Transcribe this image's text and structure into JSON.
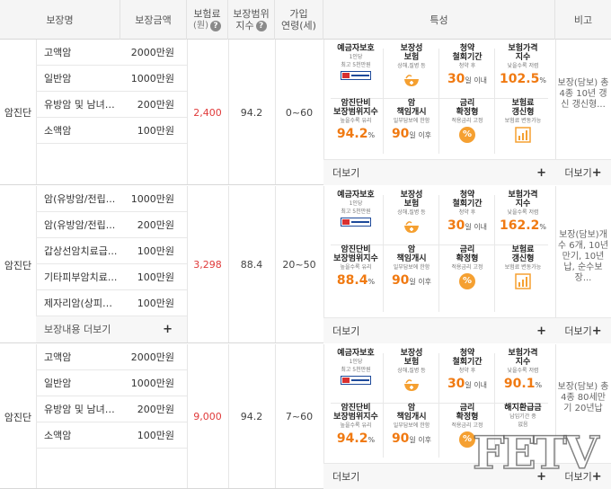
{
  "header": {
    "col_coverage_name": "보장명",
    "col_coverage_amount": "보장금액",
    "col_premium": "보험료",
    "col_premium_unit": "(원)",
    "col_index": "보장범위",
    "col_index_2": "지수",
    "col_age": "가입",
    "col_age_2": "연령(세)",
    "col_features": "특성",
    "col_note": "비고"
  },
  "feature_labels": {
    "deposit_title": "예금자보호",
    "deposit_sub1": "1인당",
    "deposit_sub2": "최고 5천만원",
    "savings_title1": "보장성",
    "savings_title2": "보험",
    "savings_sub": "상해,질병 등",
    "withdraw_title1": "청약",
    "withdraw_title2": "철회기간",
    "withdraw_sub": "청약 후",
    "withdraw_unit": "일 이내",
    "price_title1": "보험가격",
    "price_title2": "지수",
    "price_sub": "낮을수록 저렴",
    "range_title1": "암진단비",
    "range_title2": "보장범위지수",
    "range_sub": "높을수록 유리",
    "resp_title1": "암",
    "resp_title2": "책임개시",
    "resp_sub": "일부담보에 한함",
    "resp_unit": "일 이후",
    "rate_title1": "금리",
    "rate_title2": "확정형",
    "rate_sub": "적용금리 고정",
    "renew_title1": "보험료",
    "renew_title2": "갱신형",
    "renew_sub": "보험료 변동가능",
    "refund_title1": "해지환급금",
    "refund_title2": "납입기간 중",
    "refund_sub": "없음"
  },
  "more_label": "더보기",
  "coverage_more_label": "보장내용 더보기",
  "products": [
    {
      "category": "암진단",
      "premium": "2,400",
      "index": "94.2",
      "age": "0~60",
      "coverages": [
        {
          "name": "고액암",
          "amount": "2000만원"
        },
        {
          "name": "일반암",
          "amount": "1000만원"
        },
        {
          "name": "유방암 및 남녀생...",
          "amount": "200만원"
        },
        {
          "name": "소액암",
          "amount": "100만원"
        }
      ],
      "withdraw_days": "30",
      "price_index": "102.5",
      "range_index": "94.2",
      "resp_days": "90",
      "note": "보장(담보) 총 4종 10년 갱신 갱신형..."
    },
    {
      "category": "암진단",
      "premium": "3,298",
      "index": "88.4",
      "age": "20~50",
      "coverages": [
        {
          "name": "암(유방암/전립...",
          "amount": "1000만원"
        },
        {
          "name": "암(유방암/전립...",
          "amount": "200만원"
        },
        {
          "name": "갑상선암치료급...",
          "amount": "100만원"
        },
        {
          "name": "기타피부암치료...",
          "amount": "100만원"
        },
        {
          "name": "제자리암(상피내...",
          "amount": "100만원"
        }
      ],
      "withdraw_days": "30",
      "price_index": "162.2",
      "range_index": "88.4",
      "resp_days": "90",
      "note": "보장(담보)개수 6개, 10년만기, 10년납, 순수보장..."
    },
    {
      "category": "암진단",
      "premium": "9,000",
      "index": "94.2",
      "age": "7~60",
      "coverages": [
        {
          "name": "고액암",
          "amount": "2000만원"
        },
        {
          "name": "일반암",
          "amount": "1000만원"
        },
        {
          "name": "유방암 및 남녀생...",
          "amount": "200만원"
        },
        {
          "name": "소액암",
          "amount": "100만원"
        }
      ],
      "withdraw_days": "30",
      "price_index": "90.1",
      "range_index": "94.2",
      "resp_days": "90",
      "note": "보장(담보) 총 4종 80세만기 20년납"
    }
  ],
  "watermark": "FETV",
  "colors": {
    "premium": "#e03a3a",
    "accent": "#f07a12",
    "badge_blue": "#1e4a9a"
  }
}
